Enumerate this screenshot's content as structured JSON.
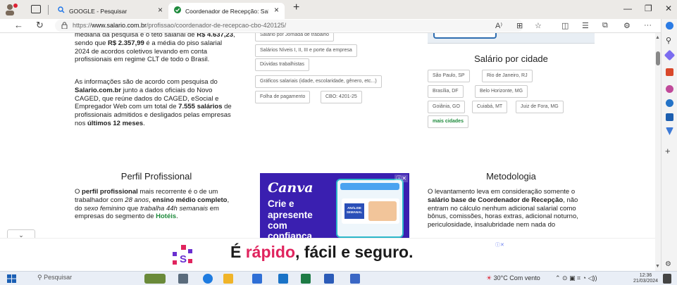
{
  "browser": {
    "tabs": [
      {
        "title": "GOOGLE - Pesquisar"
      },
      {
        "title": "Coordenador de Recepção: Salá"
      }
    ],
    "url_prefix": "https://",
    "url_domain": "www.salario.com.br",
    "url_path": "/profissao/coordenador-de-recepcao-cbo-420125/"
  },
  "left_col": {
    "p1_a": "mediana da pesquisa e o teto salarial de ",
    "p1_b": "R$ 4.637,23",
    "p1_c": ", sendo que ",
    "p1_d": "R$ 2.357,99",
    "p1_e": " é a média do piso salarial 2024 de acordos coletivos levando em conta profissionais em regime CLT de todo o Brasil.",
    "p2_a": "As informações são de acordo com pesquisa do ",
    "p2_b": "Salario.com.br",
    "p2_c": " junto a dados oficiais do Novo CAGED, que reúne dados do CAGED, eSocial e Empregador Web com um total de ",
    "p2_d": "7.555 salários",
    "p2_e": " de profissionais admitidos e desligados pelas empresas nos ",
    "p2_f": "últimos 12 meses",
    "p2_g": "."
  },
  "mid_links": {
    "items": [
      "Salário por Jornada de trabalho",
      "Salários Níveis I, II, III e porte da empresa",
      "Dúvidas trabalhistas",
      "Gráficos salariais (idade, escolaridade, gênero, etc...)",
      "Folha de pagamento",
      "CBO: 4201-25"
    ]
  },
  "cities": {
    "title": "Salário por cidade",
    "items": [
      "São Paulo, SP",
      "Rio de Janeiro, RJ",
      "Brasília, DF",
      "Belo Horizonte, MG",
      "Goiânia, GO",
      "Cuiabá, MT",
      "Juiz de Fora, MG"
    ],
    "more": "mais cidades"
  },
  "perfil": {
    "title": "Perfil Profissional",
    "t1": "O ",
    "t2": "perfil profissional",
    "t3": " mais recorrente é o de um trabalhador com ",
    "t4": "28 anos",
    "t5": ", ",
    "t6": "ensino médio completo",
    "t7": ", do ",
    "t8": "sexo feminino",
    "t9": " que ",
    "t10": "trabalha 44h semanais",
    "t11": " em empresas do segmento de ",
    "t12": "Hotéis",
    "t13": "."
  },
  "canva_ad": {
    "logo": "Canva",
    "line1": "Crie e",
    "line2": "apresente",
    "line3": "com",
    "line4": "confiança",
    "card_tag": "ANÁLISE SEMANAL"
  },
  "metodologia": {
    "title": "Metodologia",
    "t1": "O levantamento leva em consideração somente o ",
    "t2": "salário base de Coordenador de Recepção",
    "t3": ", não entram no cálculo nenhum adicional salarial como bônus, comissões, horas extras, adicional noturno, periculosidade, insalubridade nem nada do"
  },
  "ad_banner": {
    "pre": "É ",
    "accent": "rápido",
    "post": ", fácil e seguro."
  },
  "taskbar": {
    "search": "Pesquisar",
    "weather": "30°C  Com vento",
    "time": "12:36",
    "date": "21/03/2024"
  },
  "colors": {
    "green": "#1e8a3c",
    "canva_purple": "#3a1fb0",
    "ad_accent": "#e0245e"
  }
}
